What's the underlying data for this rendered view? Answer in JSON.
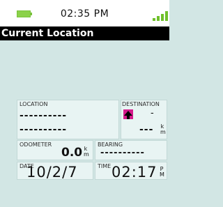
{
  "status": {
    "time": "02:35 PM",
    "battery_color": "#8bd14a",
    "signal_color": "#6fc02b"
  },
  "header": {
    "title": "Current Location"
  },
  "location": {
    "label": "LOCATION",
    "line1": "----------",
    "line2": "----------"
  },
  "destination": {
    "label": "DESTINATION",
    "direction": "-",
    "distance": "---",
    "unit_top": "k",
    "unit_bottom": "m"
  },
  "odometer": {
    "label": "ODOMETER",
    "value": "0.0",
    "unit_top": "k",
    "unit_bottom": "m"
  },
  "bearing": {
    "label": "BEARING",
    "value": "----------"
  },
  "date": {
    "label": "DATE",
    "value": "10/2/7"
  },
  "clock": {
    "label": "TIME",
    "value": "02:17",
    "unit_top": "P",
    "unit_bottom": "M"
  },
  "colors": {
    "background": "#d2e6e4",
    "panel": "#e8f4f3",
    "titlebar": "#000000",
    "arrow_box": "#d6198c"
  }
}
